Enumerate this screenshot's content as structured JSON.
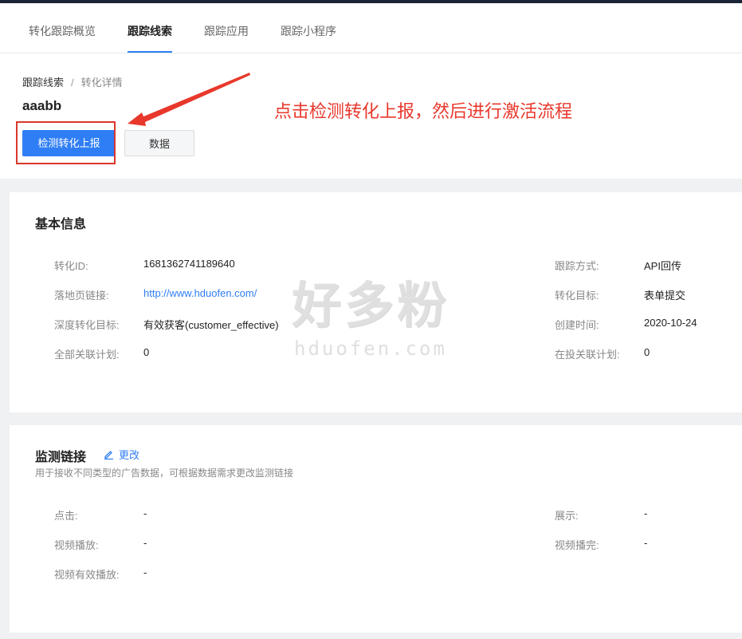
{
  "tabs": [
    {
      "label": "转化跟踪概览",
      "active": false
    },
    {
      "label": "跟踪线索",
      "active": true
    },
    {
      "label": "跟踪应用",
      "active": false
    },
    {
      "label": "跟踪小程序",
      "active": false
    }
  ],
  "breadcrumb": {
    "parent": "跟踪线索",
    "separator": "/",
    "current": "转化详情"
  },
  "page_title": "aaabb",
  "buttons": {
    "detect": "检测转化上报",
    "data": "数据"
  },
  "annotation": "点击检测转化上报，然后进行激活流程",
  "basic_info": {
    "title": "基本信息",
    "left": [
      {
        "label": "转化ID:",
        "value": "1681362741189640"
      },
      {
        "label": "落地页链接:",
        "value": "http://www.hduofen.com/"
      },
      {
        "label": "深度转化目标:",
        "value": "有效获客(customer_effective)"
      },
      {
        "label": "全部关联计划:",
        "value": "0"
      }
    ],
    "right": [
      {
        "label": "跟踪方式:",
        "value": "API回传"
      },
      {
        "label": "转化目标:",
        "value": "表单提交"
      },
      {
        "label": "创建时间:",
        "value": "2020-10-24"
      },
      {
        "label": "在投关联计划:",
        "value": "0"
      }
    ]
  },
  "monitor": {
    "title": "监测链接",
    "edit_label": "更改",
    "subtitle": "用于接收不同类型的广告数据，可根据数据需求更改监测链接",
    "left": [
      {
        "label": "点击:",
        "value": "-"
      },
      {
        "label": "视频播放:",
        "value": "-"
      },
      {
        "label": "视频有效播放:",
        "value": "-"
      }
    ],
    "right": [
      {
        "label": "展示:",
        "value": "-"
      },
      {
        "label": "视频播完:",
        "value": "-"
      }
    ]
  },
  "watermark": {
    "text": "好多粉",
    "domain": "hduofen.com"
  },
  "colors": {
    "primary": "#2f7ef5",
    "annotation": "#e8382c",
    "topbar": "#1c2438"
  }
}
